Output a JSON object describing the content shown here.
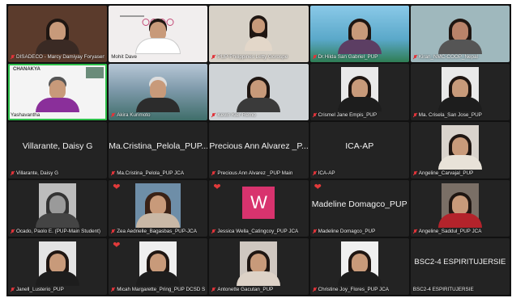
{
  "meeting": {
    "tiles": [
      {
        "label": "DISADECO - Marcy Damiyay Foryasen",
        "mic_muted": true
      },
      {
        "label": "Mohit Dave",
        "mic_muted": false
      },
      {
        "label": "PUP-Philippines Letty Gorospe",
        "mic_muted": true
      },
      {
        "label": "Dr.Hilda San Gabriel_PUP",
        "mic_muted": true
      },
      {
        "label": "Kiran_NMC-COOP_Nepal",
        "mic_muted": true
      },
      {
        "label": "Yashavantha",
        "mic_muted": false,
        "logo_text": "CHANAKYA"
      },
      {
        "label": "Akira Kurimoto",
        "mic_muted": true
      },
      {
        "label": "Kevin Kier Remo",
        "mic_muted": true
      },
      {
        "label": "Crismel Jane Empis_PUP",
        "mic_muted": true
      },
      {
        "label": "Ma. Crisela_San Jose_PUP",
        "mic_muted": true
      },
      {
        "label": "Villarante, Daisy G",
        "mic_muted": true,
        "display_name": "Villarante, Daisy G"
      },
      {
        "label": "Ma.Cristina_Pelola_PUP JCA",
        "mic_muted": true,
        "display_name": "Ma.Cristina_Pelola_PUP..."
      },
      {
        "label": "Precious Ann Alvarez _PUP Main",
        "mic_muted": true,
        "display_name": "Precious Ann Alvarez _P..."
      },
      {
        "label": "ICA-AP",
        "mic_muted": true,
        "display_name": "ICA-AP"
      },
      {
        "label": "Angeline_Carvajal_PUP",
        "mic_muted": true
      },
      {
        "label": "Ocado, Paolo E. (PUP-Main Student)",
        "mic_muted": true
      },
      {
        "label": "Zea Aedrielle_Bagasbas_PUP-JCA",
        "mic_muted": true,
        "reaction": "❤"
      },
      {
        "label": "Jessica Wella_Catingcoy_PUP JCA",
        "mic_muted": true,
        "reaction": "❤",
        "avatar_letter": "W"
      },
      {
        "label": "Madeline Domagco_PUP",
        "mic_muted": true,
        "reaction": "❤",
        "display_name": "Madeline Domagco_PUP"
      },
      {
        "label": "Angeline_Saddul_PUP JCA",
        "mic_muted": true
      },
      {
        "label": "Janell_Lusterio_PUP",
        "mic_muted": true
      },
      {
        "label": "Micah Margarette_Pring_PUP DCSD S...",
        "mic_muted": true,
        "reaction": "❤"
      },
      {
        "label": "Antonette Gacutan_PUP",
        "mic_muted": true
      },
      {
        "label": "Christine Joy_Flores_PUP JCA",
        "mic_muted": true
      },
      {
        "label": "BSC2-4 ESPIRITUJERSIE",
        "mic_muted": false,
        "display_name": "BSC2-4 ESPIRITUJERSIE"
      }
    ]
  },
  "colors": {
    "background": "#111111",
    "tile": "#232323",
    "active_speaker": "#2dbf4a",
    "muted_mic": "#e0343a",
    "heart": "#e23a3a",
    "avatar_w": "#d8336e"
  }
}
